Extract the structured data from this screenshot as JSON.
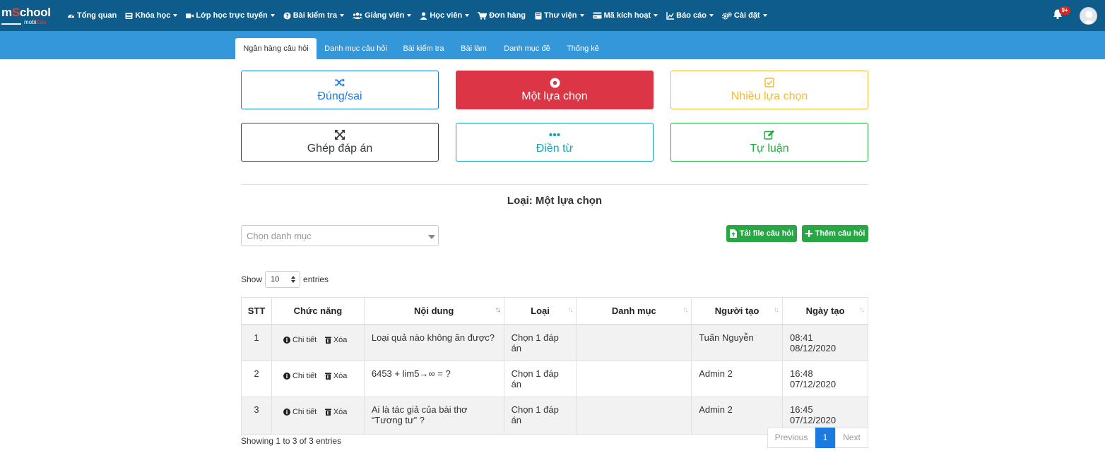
{
  "brand": {
    "logo_main_a": "m",
    "logo_main_b": "S",
    "logo_main_c": "chool",
    "logo_sub_a": "mobi",
    "logo_sub_b": "Edu"
  },
  "topnav": {
    "items": [
      {
        "label": "Tổng quan",
        "icon": "dashboard-icon",
        "caret": false
      },
      {
        "label": "Khóa học",
        "icon": "list-icon",
        "caret": true
      },
      {
        "label": "Lớp học trực tuyến",
        "icon": "video-icon",
        "caret": true
      },
      {
        "label": "Bài kiểm tra",
        "icon": "question-icon",
        "caret": true
      },
      {
        "label": "Giảng viên",
        "icon": "users-icon",
        "caret": true
      },
      {
        "label": "Học viên",
        "icon": "user-icon",
        "caret": true
      },
      {
        "label": "Đơn hàng",
        "icon": "cart-icon",
        "caret": false
      },
      {
        "label": "Thư viện",
        "icon": "book-icon",
        "caret": true
      },
      {
        "label": "Mã kích hoạt",
        "icon": "card-icon",
        "caret": true
      },
      {
        "label": "Báo cáo",
        "icon": "chart-icon",
        "caret": true
      },
      {
        "label": "Cài đặt",
        "icon": "gear-icon",
        "caret": true
      }
    ],
    "notification_badge": "9+"
  },
  "subtabs": [
    {
      "label": "Ngân hàng câu hỏi",
      "active": true
    },
    {
      "label": "Danh mục câu hỏi",
      "active": false
    },
    {
      "label": "Bài kiểm tra",
      "active": false
    },
    {
      "label": "Bài làm",
      "active": false
    },
    {
      "label": "Danh mục đề",
      "active": false
    },
    {
      "label": "Thống kê",
      "active": false
    }
  ],
  "question_types": [
    {
      "label": "Đúng/sai",
      "icon": "shuffle-icon",
      "color": "#1a7ae0",
      "selected": false
    },
    {
      "label": "Một lựa chọn",
      "icon": "dot-circle-icon",
      "color": "#dc3545",
      "selected": true
    },
    {
      "label": "Nhiều lựa chọn",
      "icon": "check-square-icon",
      "color": "#f0b93b",
      "selected": false
    },
    {
      "label": "Ghép đáp án",
      "icon": "expand-icon",
      "color": "#343a40",
      "selected": false
    },
    {
      "label": "Điền từ",
      "icon": "ellipsis-icon",
      "color": "#17a2b8",
      "selected": false
    },
    {
      "label": "Tự luận",
      "icon": "edit-icon",
      "color": "#28a745",
      "selected": false
    }
  ],
  "type_title": "Loại: Một lựa chọn",
  "category_select": {
    "placeholder": "Chọn danh mục"
  },
  "actions": {
    "upload": "Tải file câu hỏi",
    "add": "Thêm câu hỏi"
  },
  "length": {
    "prefix": "Show",
    "value": "10",
    "suffix": "entries"
  },
  "table": {
    "columns": [
      "STT",
      "Chức năng",
      "Nội dung",
      "Loại",
      "Danh mục",
      "Người tạo",
      "Ngày tạo"
    ],
    "detail_label": "Chi tiết",
    "delete_label": "Xóa",
    "rows": [
      {
        "stt": "1",
        "content": "Loại quả nào không ăn được?",
        "type": "Chọn 1 đáp án",
        "category": "",
        "creator": "Tuấn Nguyễn",
        "created": "08:41 08/12/2020"
      },
      {
        "stt": "2",
        "content": "6453 + lim5→∞ = ?",
        "type": "Chọn 1 đáp án",
        "category": "",
        "creator": "Admin 2",
        "created": "16:48 07/12/2020"
      },
      {
        "stt": "3",
        "content": "Ai là tác giả của bài thơ “Tương tư” ?",
        "type": "Chọn 1 đáp án",
        "category": "",
        "creator": "Admin 2",
        "created": "16:45 07/12/2020"
      }
    ]
  },
  "info": "Showing 1 to 3 of 3 entries",
  "pagination": {
    "previous": "Previous",
    "current": "1",
    "next": "Next"
  }
}
